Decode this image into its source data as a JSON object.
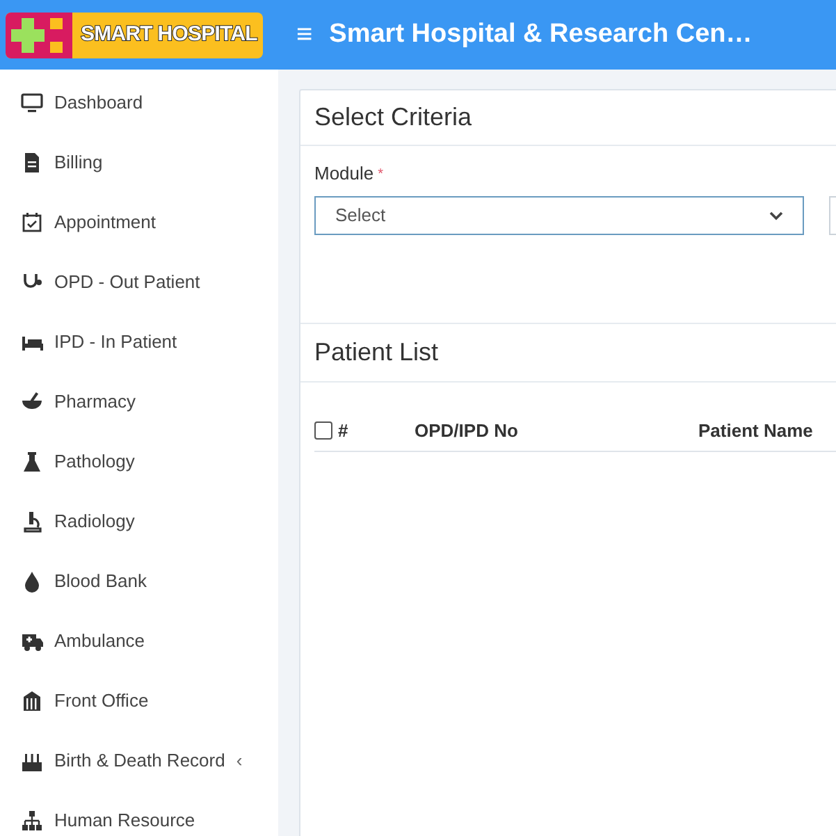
{
  "header": {
    "logo": "SMART HOSPITAL",
    "menu_glyph": "≡",
    "title": "Smart Hospital & Research Cen…"
  },
  "sidebar": {
    "items": [
      {
        "label": "Dashboard"
      },
      {
        "label": "Billing"
      },
      {
        "label": "Appointment"
      },
      {
        "label": "OPD - Out Patient"
      },
      {
        "label": "IPD - In Patient"
      },
      {
        "label": "Pharmacy"
      },
      {
        "label": "Pathology"
      },
      {
        "label": "Radiology"
      },
      {
        "label": "Blood Bank"
      },
      {
        "label": "Ambulance"
      },
      {
        "label": "Front Office"
      },
      {
        "label": "Birth & Death Record",
        "caret": "‹"
      },
      {
        "label": "Human Resource"
      }
    ]
  },
  "criteria": {
    "title": "Select Criteria",
    "fields": [
      {
        "label": "Module",
        "required_mark": "*",
        "value": "Select"
      }
    ]
  },
  "patient_list": {
    "title": "Patient List",
    "columns": [
      "#",
      "OPD/IPD No",
      "Patient Name"
    ],
    "select_all": {
      "checked": false
    }
  }
}
